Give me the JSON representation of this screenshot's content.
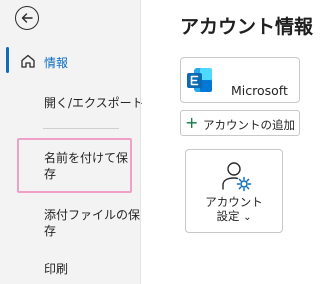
{
  "sidebar": {
    "items": [
      {
        "label": "情報"
      },
      {
        "label": "開く/エクスポート"
      },
      {
        "label_line1": "名前を付けて保",
        "label_line2": "存"
      },
      {
        "label_line1": "添付ファイルの保",
        "label_line2": "存"
      },
      {
        "label": "印刷"
      }
    ]
  },
  "main": {
    "title": "アカウント情報",
    "account": {
      "name": "Microsoft"
    },
    "add_account_label": "アカウントの追加",
    "settings": {
      "line1": "アカウント",
      "line2": "設定",
      "chevron": "⌄"
    }
  },
  "colors": {
    "accent": "#0f6cbd",
    "highlight": "#f0a0c8",
    "exchange_blue": "#0a6ab3"
  },
  "icons": [
    "back-arrow-icon",
    "home-icon",
    "exchange-icon",
    "plus-icon",
    "person-gear-icon"
  ]
}
